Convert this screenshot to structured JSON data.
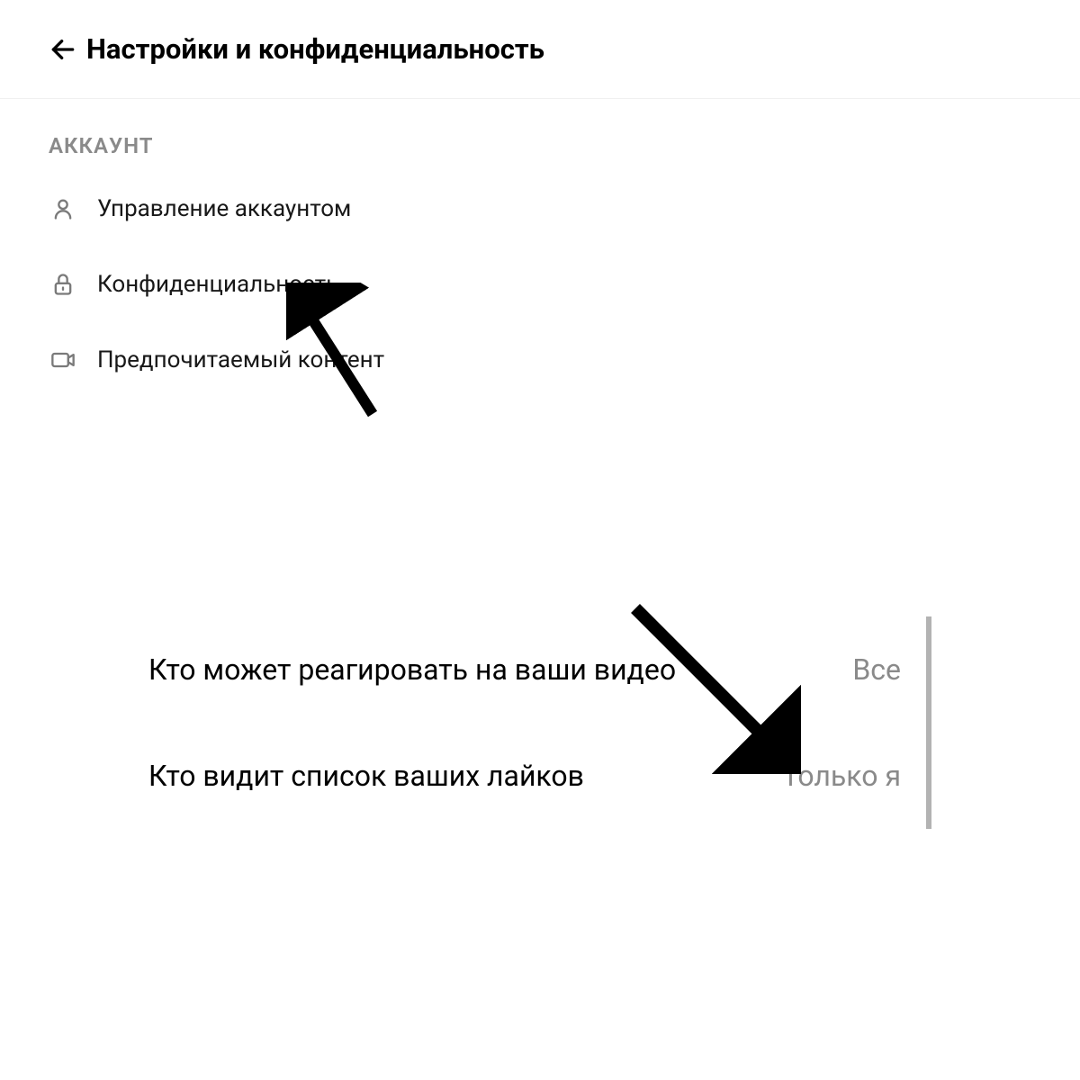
{
  "header": {
    "title": "Настройки и конфиденциальность"
  },
  "sections": {
    "account": {
      "label": "АККАУНТ",
      "items": [
        {
          "icon": "person-icon",
          "label": "Управление аккаунтом"
        },
        {
          "icon": "lock-icon",
          "label": "Конфиденциальность"
        },
        {
          "icon": "video-icon",
          "label": "Предпочитаемый контент"
        }
      ]
    }
  },
  "privacy": {
    "rows": [
      {
        "label": "Кто может реагировать на ваши видео",
        "value": "Все"
      },
      {
        "label": "Кто видит список ваших лайков",
        "value": "Только я"
      }
    ]
  }
}
